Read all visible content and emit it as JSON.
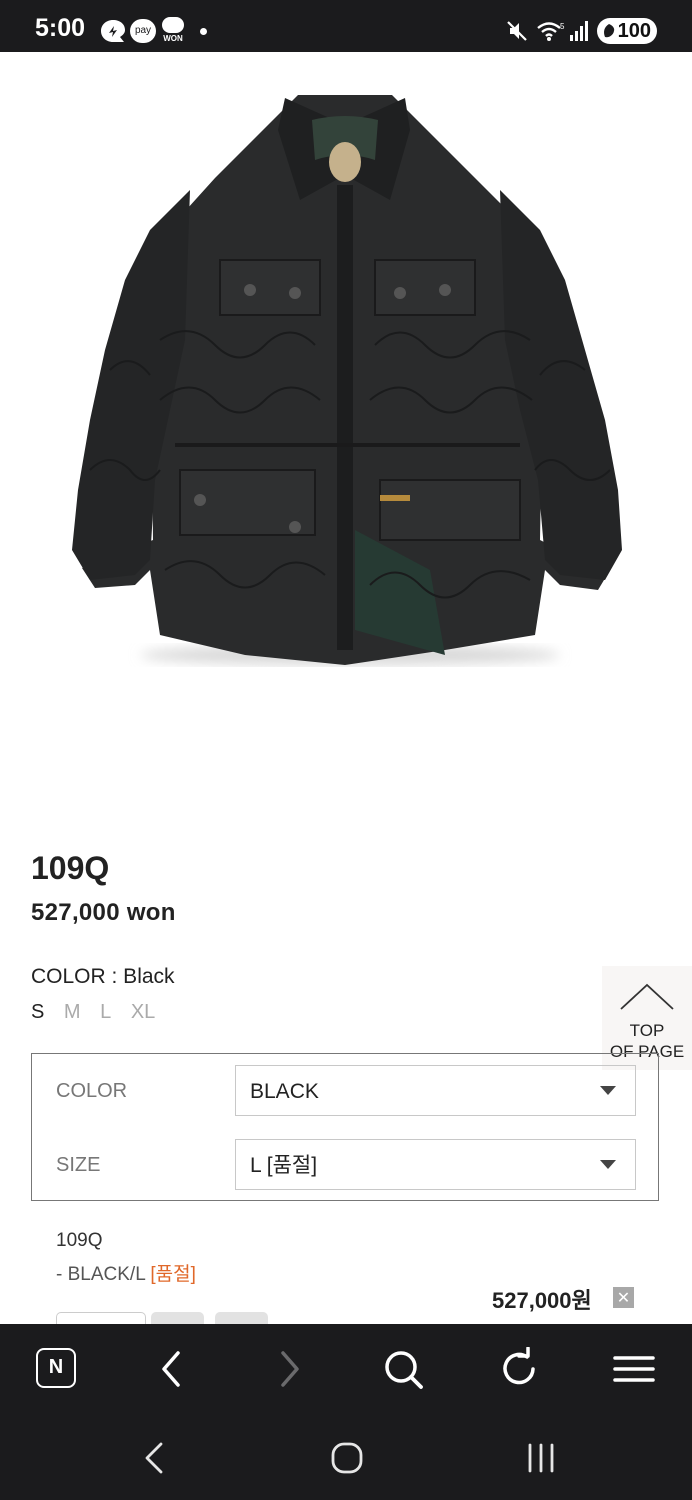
{
  "status_bar": {
    "time": "5:00",
    "battery": "100",
    "icons": [
      "moon-shield-icon",
      "pay-icon",
      "won-icon",
      "dot-icon",
      "mute-icon",
      "wifi-icon",
      "signal-icon"
    ],
    "pay_text": "pay",
    "won_text": "WON"
  },
  "product": {
    "image_icon": "quilted-black-jacket-image",
    "name": "109Q",
    "price": "527,000 won",
    "color_line": "COLOR : Black",
    "sizes": [
      {
        "label": "S",
        "selected": true
      },
      {
        "label": "M",
        "selected": false
      },
      {
        "label": "L",
        "selected": false
      },
      {
        "label": "XL",
        "selected": false
      }
    ]
  },
  "top_button": {
    "line1": "TOP",
    "line2": "OF PAGE"
  },
  "options": {
    "color_label": "COLOR",
    "color_value": "BLACK",
    "size_label": "SIZE",
    "size_value": "L [품절]"
  },
  "selected_item": {
    "name": "109Q",
    "option_prefix": "- BLACK/L ",
    "option_soldout": "[품절]",
    "price": "527,000원",
    "remove_label": "✕"
  },
  "browser_toolbar": {
    "icons": [
      "naver-home-icon",
      "back-icon",
      "forward-icon",
      "search-icon",
      "refresh-icon",
      "menu-icon"
    ],
    "home_letter": "N"
  },
  "system_nav": {
    "icons": [
      "nav-back-icon",
      "nav-home-icon",
      "nav-recents-icon"
    ]
  },
  "colors": {
    "soldout": "#e0682a",
    "bars": "#1b1b1d",
    "text": "#222222"
  }
}
